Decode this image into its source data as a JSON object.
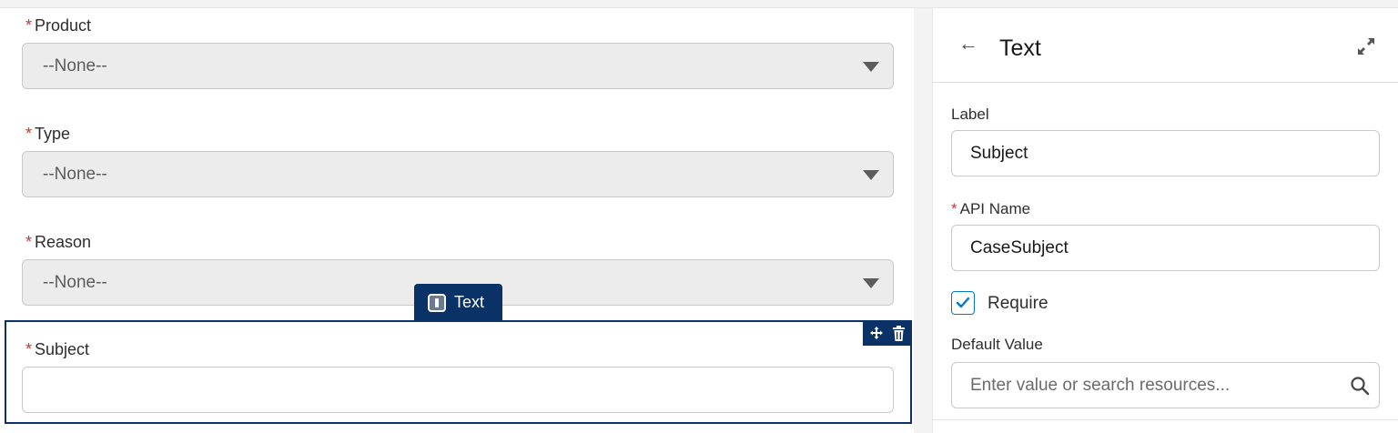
{
  "form": {
    "product": {
      "label": "Product",
      "value": "--None--"
    },
    "type": {
      "label": "Type",
      "value": "--None--"
    },
    "reason": {
      "label": "Reason",
      "value": "--None--"
    },
    "subject": {
      "label": "Subject",
      "value": ""
    },
    "required_marker": "*",
    "selected_component_tab": "Text"
  },
  "panel": {
    "title": "Text",
    "label_field": {
      "label": "Label",
      "value": "Subject"
    },
    "api_name_field": {
      "label": "API Name",
      "value": "CaseSubject"
    },
    "require": {
      "label": "Require",
      "checked": true
    },
    "default_value": {
      "label": "Default Value",
      "placeholder": "Enter value or search resources..."
    }
  },
  "icons": {
    "back": "back-arrow-icon",
    "expand": "expand-icon",
    "move": "move-icon",
    "delete": "trash-icon",
    "search": "search-icon",
    "text_component": "text-component-icon",
    "caret": "chevron-down-icon",
    "checkmark": "checkmark-icon"
  },
  "colors": {
    "selection": "#0b3266",
    "required": "#c23934",
    "checkbox_accent": "#0176d3"
  }
}
